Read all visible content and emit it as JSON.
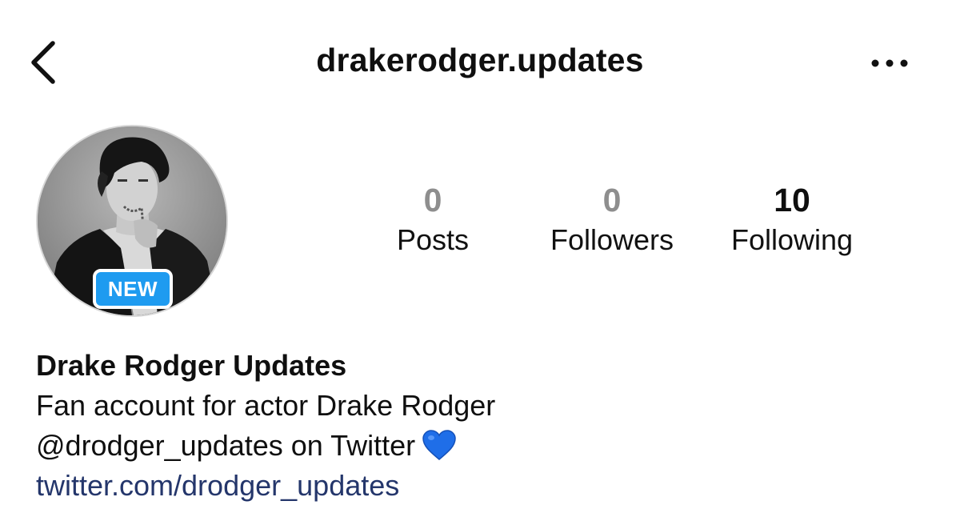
{
  "header": {
    "username": "drakerodger.updates",
    "back_icon": "chevron-left-icon",
    "more_icon": "more-horizontal-icon"
  },
  "profile": {
    "badge": "NEW",
    "stats": [
      {
        "value": "0",
        "label": "Posts"
      },
      {
        "value": "0",
        "label": "Followers"
      },
      {
        "value": "10",
        "label": "Following"
      }
    ]
  },
  "bio": {
    "display_name": "Drake Rodger Updates",
    "line1": "Fan account for actor Drake Rodger",
    "line2": "@drodger_updates on Twitter",
    "line2_emoji": "blue-heart-icon",
    "link": "twitter.com/drodger_updates"
  },
  "colors": {
    "badge_bg": "#1e9bf0",
    "link": "#24366b",
    "muted_count": "#8e8e8e",
    "heart": "#1f6ee8"
  }
}
